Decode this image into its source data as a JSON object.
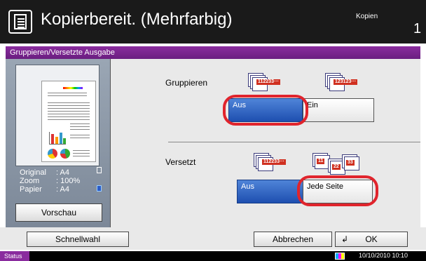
{
  "header": {
    "title": "Kopierbereit. (Mehrfarbig)",
    "mode": "Kopien",
    "count": "1",
    "icon": "copy-document-icon"
  },
  "panel": {
    "title": "Gruppieren/Versetzte Ausgabe"
  },
  "preview": {
    "rows": [
      {
        "key": "Original",
        "value": ": A4"
      },
      {
        "key": "Zoom",
        "value": ": 100%"
      },
      {
        "key": "Papier",
        "value": ": A4"
      }
    ],
    "button": "Vorschau"
  },
  "gruppieren": {
    "label": "Gruppieren",
    "options": [
      {
        "label": "Aus",
        "selected": true
      },
      {
        "label": "Ein",
        "selected": false
      }
    ],
    "icon_off_text": "112233···",
    "icon_on_text": "123123···"
  },
  "versetzt": {
    "label": "Versetzt",
    "options": [
      {
        "label": "Aus",
        "selected": true
      },
      {
        "label": "Jede Seite",
        "selected": false
      }
    ],
    "icon_off_text": "112233···",
    "icon_on_texts": [
      "11",
      "22",
      "33"
    ]
  },
  "footer": {
    "quick": "Schnellwahl",
    "cancel": "Abbrechen",
    "ok": "OK"
  },
  "statusbar": {
    "status": "Status",
    "datetime": "10/10/2010  10:10"
  },
  "colors": {
    "accent": "#8a2c9e",
    "selected": "#1e4fb0",
    "highlight": "#e0242c"
  }
}
